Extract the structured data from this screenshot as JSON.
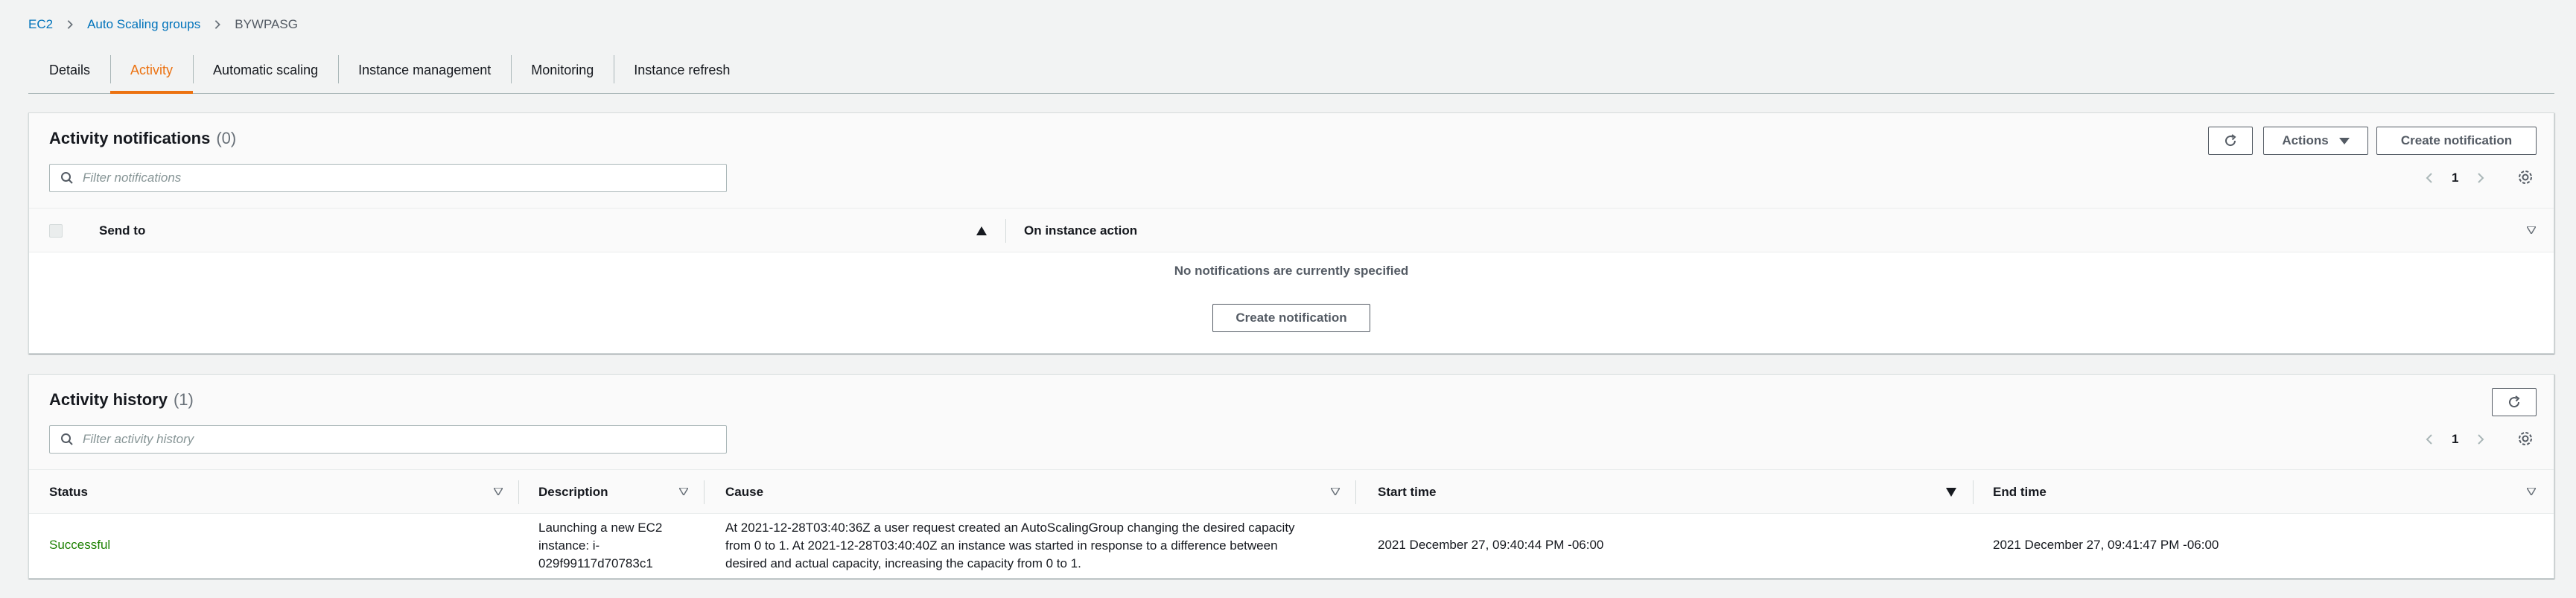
{
  "breadcrumb": {
    "items": [
      {
        "label": "EC2"
      },
      {
        "label": "Auto Scaling groups"
      }
    ],
    "current": "BYWPASG"
  },
  "tabs": [
    {
      "label": "Details",
      "active": false
    },
    {
      "label": "Activity",
      "active": true
    },
    {
      "label": "Automatic scaling",
      "active": false
    },
    {
      "label": "Instance management",
      "active": false
    },
    {
      "label": "Monitoring",
      "active": false
    },
    {
      "label": "Instance refresh",
      "active": false
    }
  ],
  "notifications": {
    "title": "Activity notifications",
    "count": "(0)",
    "actions_label": "Actions",
    "create_label": "Create notification",
    "filter_placeholder": "Filter notifications",
    "page": "1",
    "columns": {
      "send_to": "Send to",
      "on_instance_action": "On instance action"
    },
    "empty_message": "No notifications are currently specified",
    "empty_create_label": "Create notification"
  },
  "history": {
    "title": "Activity history",
    "count": "(1)",
    "filter_placeholder": "Filter activity history",
    "page": "1",
    "columns": {
      "status": "Status",
      "description": "Description",
      "cause": "Cause",
      "start_time": "Start time",
      "end_time": "End time"
    },
    "rows": [
      {
        "status": "Successful",
        "description": [
          "Launching a new EC2",
          "instance: i-",
          "029f99117d70783c1"
        ],
        "cause": [
          "At 2021-12-28T03:40:36Z a user request created an AutoScalingGroup changing the desired capacity",
          "from 0 to 1. At 2021-12-28T03:40:40Z an instance was started in response to a difference between",
          "desired and actual capacity, increasing the capacity from 0 to 1."
        ],
        "start_time": "2021 December 27, 09:40:44 PM -06:00",
        "end_time": "2021 December 27, 09:41:47 PM -06:00"
      }
    ]
  },
  "colors": {
    "link": "#0073bb",
    "accent": "#ec7211",
    "success": "#1d8102",
    "background": "#f2f3f3"
  },
  "icons": {
    "refresh": "refresh-icon",
    "search": "search-icon",
    "settings": "gear-icon",
    "prev": "chevron-left-icon",
    "next": "chevron-right-icon",
    "sort": "sort-caret-icon",
    "breadcrumb_sep": "chevron-right-icon"
  }
}
